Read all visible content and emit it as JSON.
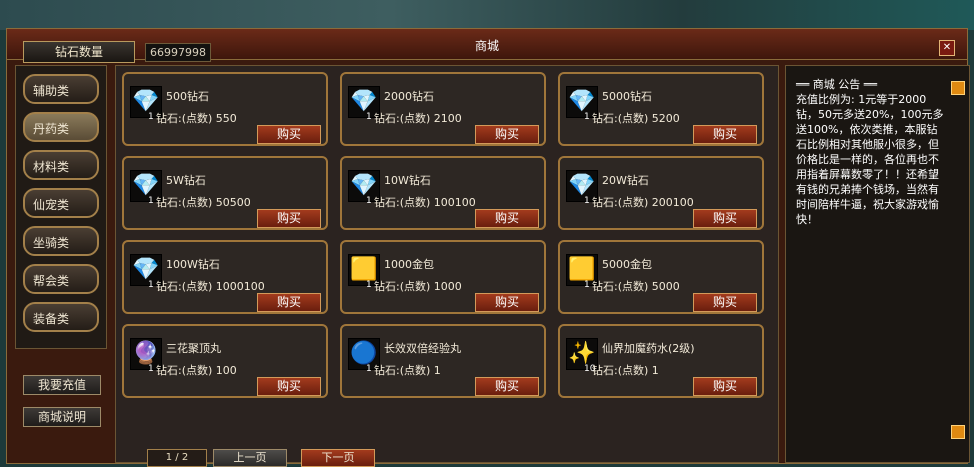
{
  "window": {
    "title": "商城",
    "tab_label": "钻石数量",
    "diamond_count": "66997998",
    "close": "✕"
  },
  "categories": [
    "辅助类",
    "丹药类",
    "材料类",
    "仙宠类",
    "坐骑类",
    "帮会类",
    "装备类"
  ],
  "side_buttons": {
    "recharge": "我要充值",
    "help": "商城说明"
  },
  "items": [
    {
      "name": "500钻石",
      "qty": "1",
      "price": "钻石:(点数) 550",
      "buy": "购买",
      "icon": "💎"
    },
    {
      "name": "2000钻石",
      "qty": "1",
      "price": "钻石:(点数) 2100",
      "buy": "购买",
      "icon": "💎"
    },
    {
      "name": "5000钻石",
      "qty": "1",
      "price": "钻石:(点数) 5200",
      "buy": "购买",
      "icon": "💎"
    },
    {
      "name": "5W钻石",
      "qty": "1",
      "price": "钻石:(点数) 50500",
      "buy": "购买",
      "icon": "💎"
    },
    {
      "name": "10W钻石",
      "qty": "1",
      "price": "钻石:(点数) 100100",
      "buy": "购买",
      "icon": "💎"
    },
    {
      "name": "20W钻石",
      "qty": "1",
      "price": "钻石:(点数) 200100",
      "buy": "购买",
      "icon": "💎"
    },
    {
      "name": "100W钻石",
      "qty": "1",
      "price": "钻石:(点数) 1000100",
      "buy": "购买",
      "icon": "💎"
    },
    {
      "name": "1000金包",
      "qty": "1",
      "price": "钻石:(点数) 1000",
      "buy": "购买",
      "icon": "🟨"
    },
    {
      "name": "5000金包",
      "qty": "1",
      "price": "钻石:(点数) 5000",
      "buy": "购买",
      "icon": "🟨"
    },
    {
      "name": "三花聚顶丸",
      "qty": "1",
      "price": "钻石:(点数) 100",
      "buy": "购买",
      "icon": "🔮"
    },
    {
      "name": "长效双倍经验丸",
      "qty": "1",
      "price": "钻石:(点数) 1",
      "buy": "购买",
      "icon": "🔵"
    },
    {
      "name": "仙界加魔药水(2级)",
      "qty": "10",
      "price": "钻石:(点数) 1",
      "buy": "购买",
      "icon": "✨"
    }
  ],
  "pagination": {
    "page": "1 / 2",
    "prev": "上一页",
    "next": "下一页"
  },
  "notice": {
    "head": "══ 商城 公告 ══",
    "body": "充值比例为: 1元等于2000钻，50元多送20%，100元多送100%，依次类推，本服钻石比例相对其他服小很多，但价格比是一样的，各位再也不用指着屏幕数零了！！还希望有钱的兄弟捧个钱场，当然有时间陪样牛逼，祝大家游戏愉快！"
  },
  "colors": {
    "accent": "#a0763a",
    "buy": "#a33b1d",
    "scroll": "#e08a12"
  }
}
